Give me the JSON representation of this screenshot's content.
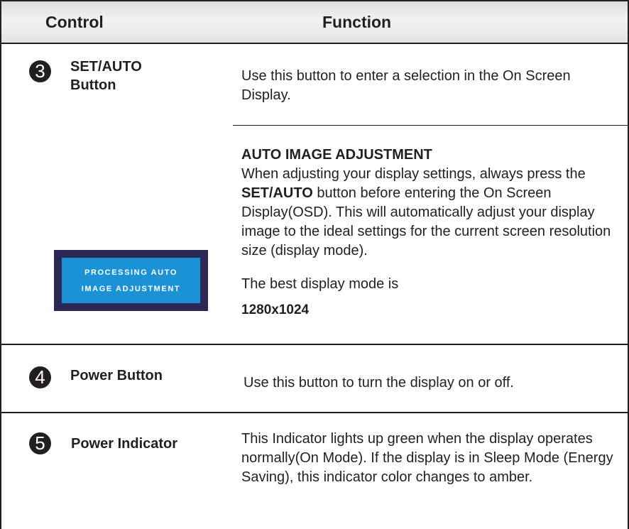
{
  "header": {
    "control": "Control",
    "function": "Function"
  },
  "rows": [
    {
      "number": "3",
      "control_line1": "SET/AUTO",
      "control_line2": "Button",
      "function": "Use this button to enter a selection in the On Screen Display."
    },
    {
      "number": "4",
      "control": "Power Button",
      "function": "Use this button to turn the display on or off."
    },
    {
      "number": "5",
      "control": "Power Indicator",
      "function": "This Indicator lights up green when the display operates normally(On Mode). If the display is in Sleep Mode (Energy Saving), this indicator color changes to amber."
    }
  ],
  "auto_adjust": {
    "heading": "AUTO IMAGE ADJUSTMENT",
    "intro": "When adjusting your display settings, always press the",
    "button_name": "SET/AUTO",
    "rest": "button before entering the On Screen Display(OSD). This will automatically adjust your display image to the ideal settings for the current screen resolution size (display mode).",
    "best_mode_label": "The best display mode is",
    "best_mode_value": "1280x1024"
  },
  "osd": {
    "line1": "PROCESSING AUTO",
    "line2": "IMAGE ADJUSTMENT",
    "frame_color": "#2a2855",
    "screen_color": "#1b92d6"
  }
}
